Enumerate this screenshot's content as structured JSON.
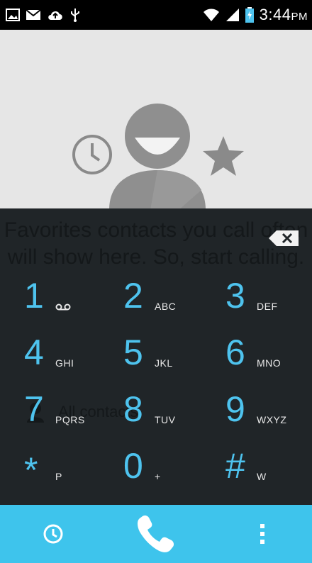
{
  "status_bar": {
    "left_icons": [
      "gallery-icon",
      "gmail-icon",
      "cloud-upload-icon",
      "usb-icon"
    ],
    "right_icons": [
      "wifi-icon",
      "signal-icon",
      "battery-charging-icon"
    ],
    "time": "3:44",
    "ampm": "PM"
  },
  "empty_state": {
    "message": "Favorites contacts you call often will show here. So, start calling.",
    "link_label": "All contacts",
    "icons": [
      "recents-clock-icon",
      "person-avatar-icon",
      "favorite-star-icon"
    ]
  },
  "dialpad": {
    "keys": [
      {
        "digit": "1",
        "letters": "",
        "icon": "voicemail-icon"
      },
      {
        "digit": "2",
        "letters": "ABC"
      },
      {
        "digit": "3",
        "letters": "DEF"
      },
      {
        "digit": "4",
        "letters": "GHI"
      },
      {
        "digit": "5",
        "letters": "JKL"
      },
      {
        "digit": "6",
        "letters": "MNO"
      },
      {
        "digit": "7",
        "letters": "PQRS"
      },
      {
        "digit": "8",
        "letters": "TUV"
      },
      {
        "digit": "9",
        "letters": "WXYZ"
      },
      {
        "digit": "*",
        "letters": "P"
      },
      {
        "digit": "0",
        "letters": "+"
      },
      {
        "digit": "#",
        "letters": "W"
      }
    ],
    "backspace_icon": "backspace-icon"
  },
  "action_bar": {
    "items": [
      "recent-calls-icon",
      "call-icon",
      "overflow-menu-icon"
    ]
  },
  "colors": {
    "accent": "#4ec3ee",
    "action_bar": "#3ec4ec",
    "dialpad_bg": "#202528"
  }
}
